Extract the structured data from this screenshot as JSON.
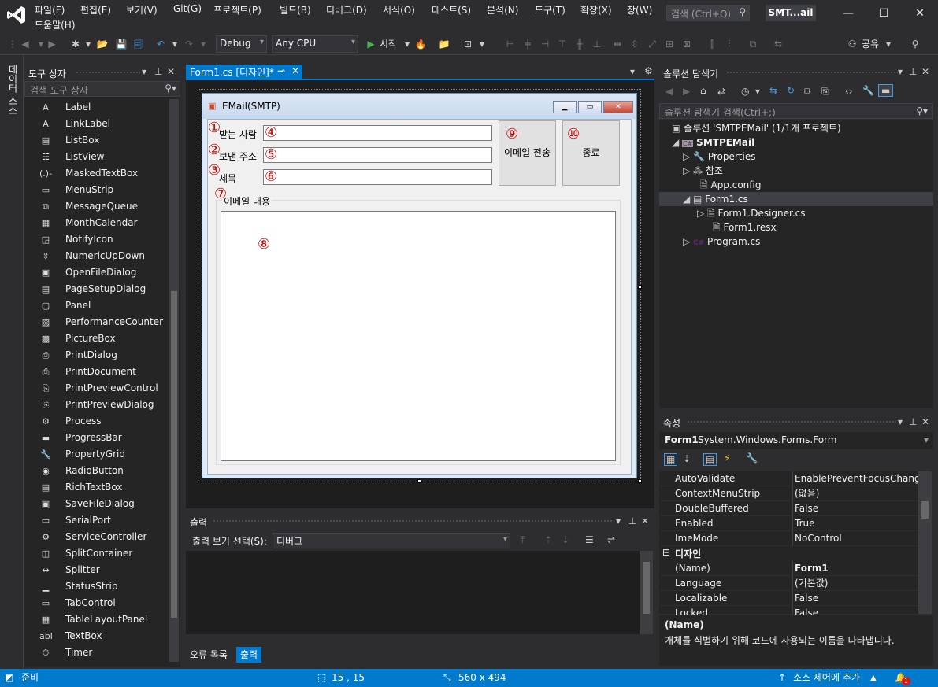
{
  "menu": {
    "items": [
      "파일(F)",
      "편집(E)",
      "보기(V)",
      "Git(G)",
      "프로젝트(P)",
      "빌드(B)",
      "디버그(D)",
      "서식(O)",
      "테스트(S)",
      "분석(N)",
      "도구(T)",
      "확장(X)",
      "창(W)",
      "도움말(H)"
    ],
    "search_placeholder": "검색 (Ctrl+Q)",
    "solution_short": "SMT...ail"
  },
  "toolbar": {
    "config": "Debug",
    "platform": "Any CPU",
    "start_label": "시작",
    "share_label": "공유"
  },
  "left_strip": {
    "label": "데이터 소스"
  },
  "toolbox": {
    "title": "도구 상자",
    "search_placeholder": "검색 도구 상자",
    "items": [
      {
        "icon": "A",
        "label": "Label"
      },
      {
        "icon": "A",
        "label": "LinkLabel"
      },
      {
        "icon": "▤",
        "label": "ListBox"
      },
      {
        "icon": "☷",
        "label": "ListView"
      },
      {
        "icon": "(.)-",
        "label": "MaskedTextBox"
      },
      {
        "icon": "▭",
        "label": "MenuStrip"
      },
      {
        "icon": "⧉",
        "label": "MessageQueue"
      },
      {
        "icon": "▦",
        "label": "MonthCalendar"
      },
      {
        "icon": "◲",
        "label": "NotifyIcon"
      },
      {
        "icon": "⇳",
        "label": "NumericUpDown"
      },
      {
        "icon": "▣",
        "label": "OpenFileDialog"
      },
      {
        "icon": "▤",
        "label": "PageSetupDialog"
      },
      {
        "icon": "▢",
        "label": "Panel"
      },
      {
        "icon": "▨",
        "label": "PerformanceCounter"
      },
      {
        "icon": "▩",
        "label": "PictureBox"
      },
      {
        "icon": "⎙",
        "label": "PrintDialog"
      },
      {
        "icon": "⎙",
        "label": "PrintDocument"
      },
      {
        "icon": "⎘",
        "label": "PrintPreviewControl"
      },
      {
        "icon": "⎘",
        "label": "PrintPreviewDialog"
      },
      {
        "icon": "⚙",
        "label": "Process"
      },
      {
        "icon": "▬",
        "label": "ProgressBar"
      },
      {
        "icon": "🔧",
        "label": "PropertyGrid"
      },
      {
        "icon": "◉",
        "label": "RadioButton"
      },
      {
        "icon": "▤",
        "label": "RichTextBox"
      },
      {
        "icon": "▣",
        "label": "SaveFileDialog"
      },
      {
        "icon": "▭",
        "label": "SerialPort"
      },
      {
        "icon": "⚙",
        "label": "ServiceController"
      },
      {
        "icon": "◫",
        "label": "SplitContainer"
      },
      {
        "icon": "↔",
        "label": "Splitter"
      },
      {
        "icon": "▁",
        "label": "StatusStrip"
      },
      {
        "icon": "▭",
        "label": "TabControl"
      },
      {
        "icon": "▦",
        "label": "TableLayoutPanel"
      },
      {
        "icon": "abl",
        "label": "TextBox"
      },
      {
        "icon": "⏱",
        "label": "Timer"
      }
    ]
  },
  "document": {
    "tab_label": "Form1.cs [디자인]*"
  },
  "form": {
    "title": "EMail(SMTP)",
    "label_to": "받는 사람",
    "label_from": "보낸 주소",
    "label_subject": "제목",
    "group_label": "이메일 내용",
    "send_button": "이메일 전송",
    "exit_button": "종료",
    "markers": [
      "①",
      "②",
      "③",
      "④",
      "⑤",
      "⑥",
      "⑦",
      "⑧",
      "⑨",
      "⑩"
    ]
  },
  "output": {
    "title": "출력",
    "show_label": "출력 보기 선택(S):",
    "source": "디버그",
    "tabs": [
      "오류 목록",
      "출력"
    ]
  },
  "solution_explorer": {
    "title": "솔루션 탐색기",
    "search_placeholder": "솔루션 탐색기 검색(Ctrl+;)",
    "items": [
      {
        "label": "솔루션 'SMTPEMail' (1/1개 프로젝트)"
      },
      {
        "label": "SMTPEMail"
      },
      {
        "label": "Properties"
      },
      {
        "label": "참조"
      },
      {
        "label": "App.config"
      },
      {
        "label": "Form1.cs"
      },
      {
        "label": "Form1.Designer.cs"
      },
      {
        "label": "Form1.resx"
      },
      {
        "label": "Program.cs"
      }
    ]
  },
  "properties": {
    "title": "속성",
    "object_name": "Form1",
    "object_type": "System.Windows.Forms.Form",
    "rows": [
      {
        "k": "AutoValidate",
        "v": "EnablePreventFocusChange"
      },
      {
        "k": "ContextMenuStrip",
        "v": "(없음)"
      },
      {
        "k": "DoubleBuffered",
        "v": "False"
      },
      {
        "k": "Enabled",
        "v": "True"
      },
      {
        "k": "ImeMode",
        "v": "NoControl"
      }
    ],
    "category": "디자인",
    "rows2": [
      {
        "k": "(Name)",
        "v": "Form1"
      },
      {
        "k": "Language",
        "v": "(기본값)"
      },
      {
        "k": "Localizable",
        "v": "False"
      },
      {
        "k": "Locked",
        "v": "False"
      }
    ],
    "desc_title": "(Name)",
    "desc_text": "개체를 식별하기 위해 코드에 사용되는 이름을 나타냅니다."
  },
  "status": {
    "ready": "준비",
    "position": "15 , 15",
    "size": "560 x 494",
    "source_control": "소스 제어에 추가",
    "notifications": "1"
  },
  "colors": {
    "accent": "#007acc",
    "background": "#2d2d30",
    "panel": "#252526",
    "marker": "#cc0000"
  }
}
